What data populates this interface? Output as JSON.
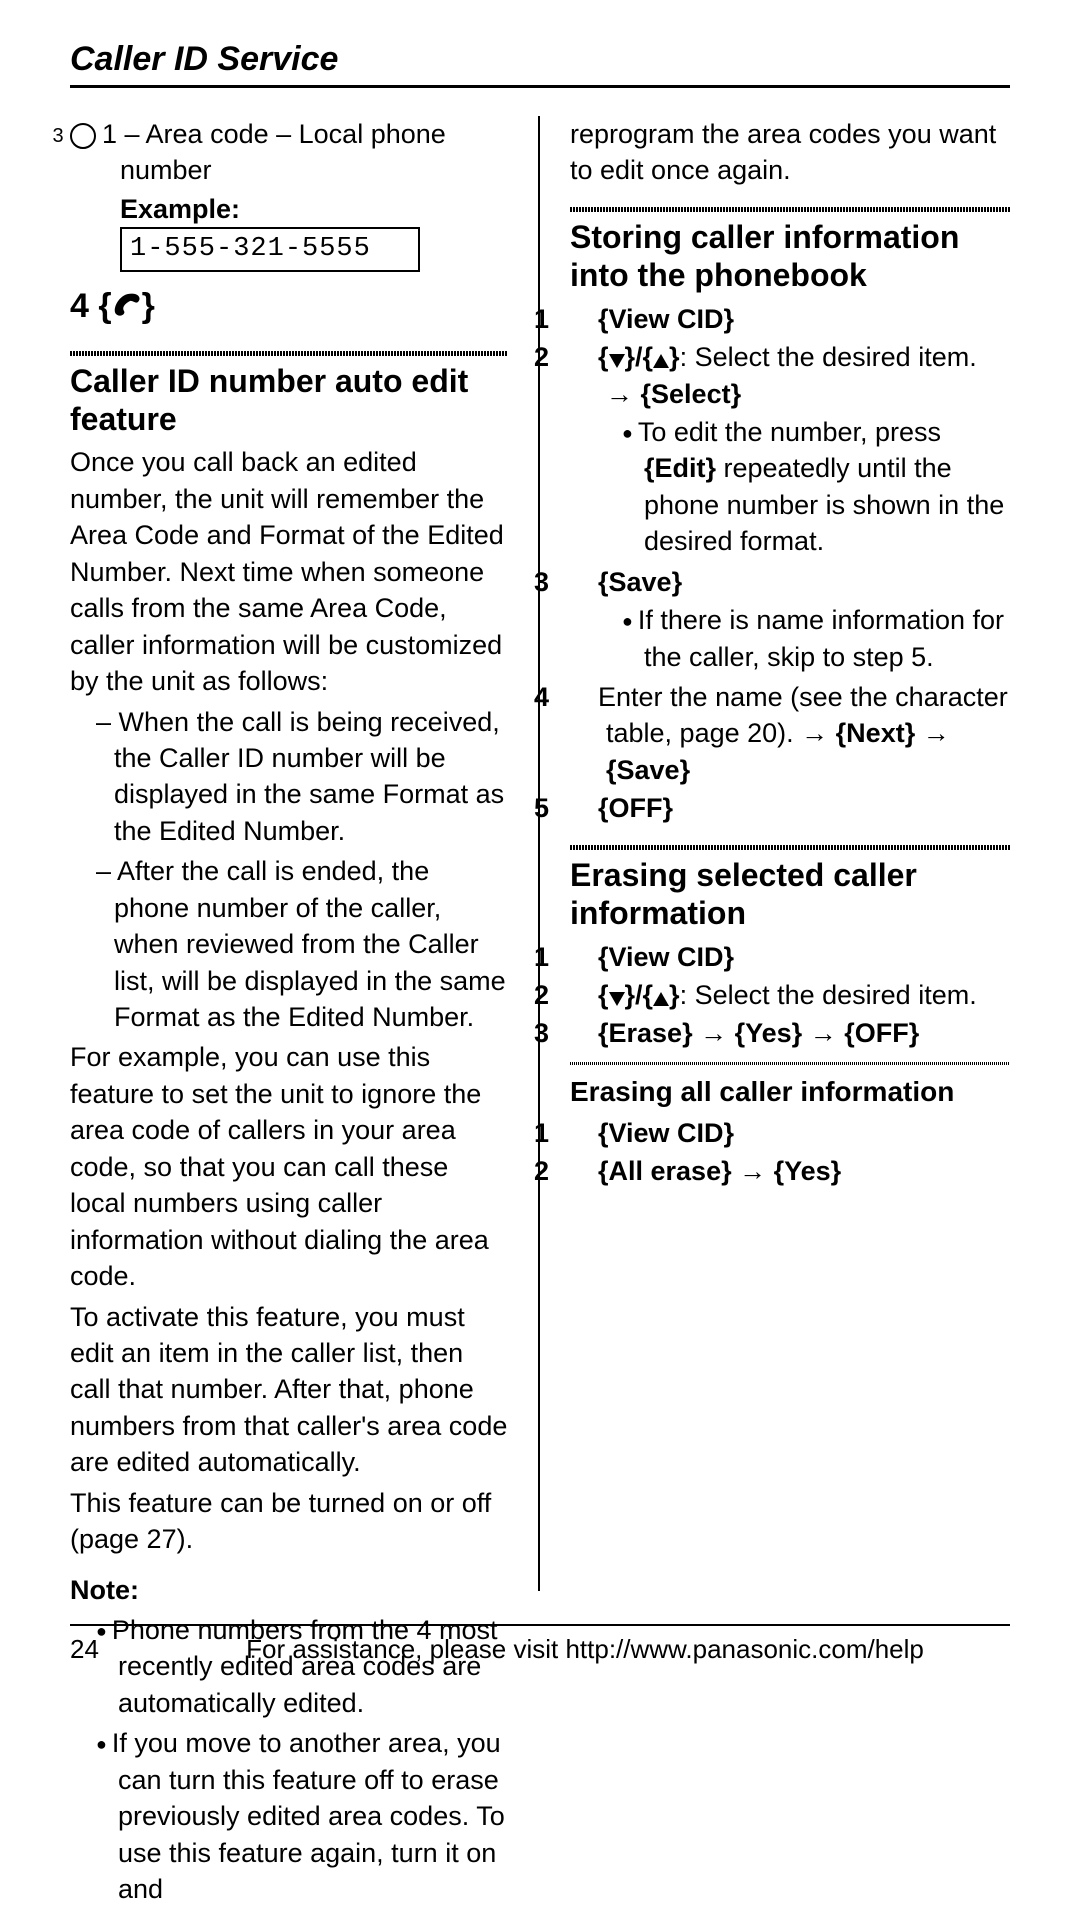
{
  "page_title": "Caller ID Service",
  "left": {
    "circled_num": "3",
    "option3": "1 – Area code – Local phone number",
    "example_label": "Example:",
    "example_value": "1-555-321-5555",
    "step4_num": "4",
    "sec1_title": "Caller ID number auto edit feature",
    "sec1_p1": "Once you call back an edited number, the unit will remember the Area Code and Format of the Edited Number. Next time when someone calls from the same Area Code, caller information will be customized by the unit as follows:",
    "sec1_d1": "When the call is being received, the Caller ID number will be displayed in the same Format as the Edited Number.",
    "sec1_d2": "After the call is ended, the phone number of the caller, when reviewed from the Caller list, will be displayed in the same Format as the Edited Number.",
    "sec1_p2": "For example, you can use this feature to set the unit to ignore the area code of callers in your area code, so that you can call these local numbers using caller information without dialing the area code.",
    "sec1_p3": "To activate this feature, you must edit an item in the caller list, then call that number. After that, phone numbers from that caller's area code are edited automatically.",
    "sec1_p4": "This feature can be turned on or off (page 27).",
    "note_label": "Note:",
    "note_b1": "Phone numbers from the 4 most recently edited area codes are automatically edited.",
    "note_b2": "If you move to another area, you can turn this feature off to erase previously edited area codes. To use this feature again, turn it on and"
  },
  "right": {
    "cont": "reprogram the area codes you want to edit once again.",
    "sec2_title": "Storing caller information into the phonebook",
    "s2_1_key": "{View CID}",
    "s2_2_text": ": Select the desired item. ",
    "s2_2_select": "{Select}",
    "s2_2_sub_pre": "To edit the number, press ",
    "s2_2_sub_key": "{Edit}",
    "s2_2_sub_post": " repeatedly until the phone number is shown in the desired format.",
    "s2_3_key": "{Save}",
    "s2_3_sub": "If there is name information for the caller, skip to step 5.",
    "s2_4_pre": "Enter the name (see the character table, page 20). ",
    "s2_4_next": "{Next}",
    "s2_4_save": "{Save}",
    "s2_5_key": "{OFF}",
    "sec3_title": "Erasing selected caller information",
    "s3_1_key": "{View CID}",
    "s3_2_text": ": Select the desired item.",
    "s3_3_erase": "{Erase}",
    "s3_3_yes": "{Yes}",
    "s3_3_off": "{OFF}",
    "sec4_title": "Erasing all caller information",
    "s4_1_key": "{View CID}",
    "s4_2_allerase": "{All erase}",
    "s4_2_yes": "{Yes}"
  },
  "footer": {
    "page_num": "24",
    "assist": "For assistance, please visit http://www.panasonic.com/help"
  }
}
